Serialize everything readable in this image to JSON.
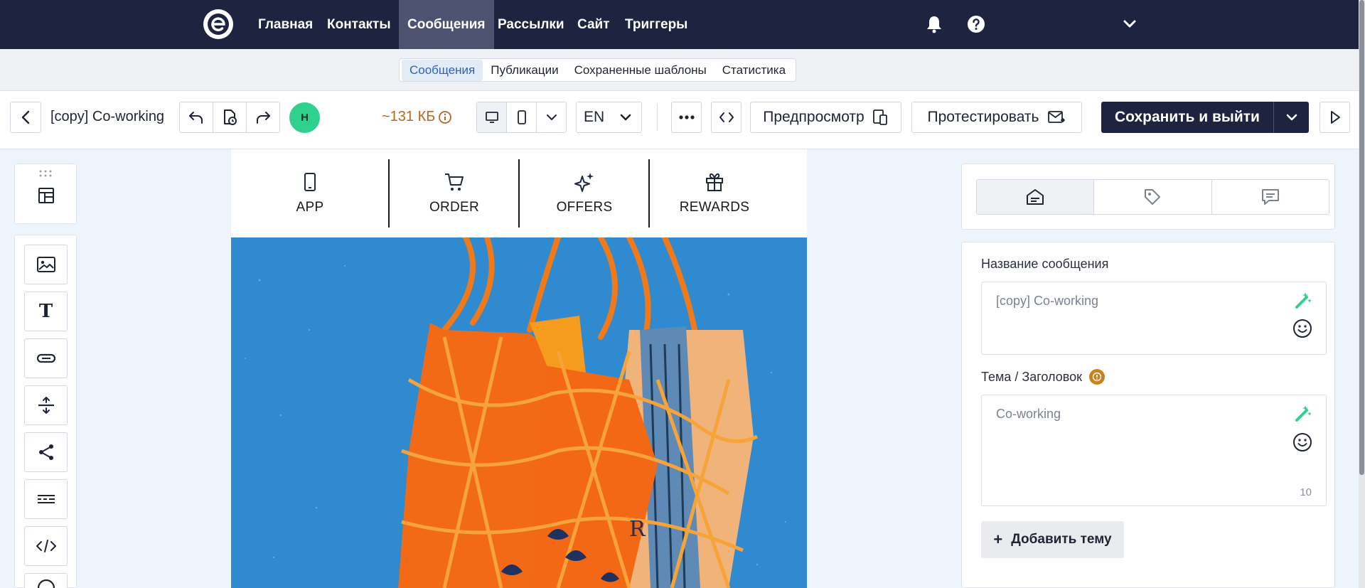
{
  "top_nav": {
    "items": [
      {
        "label": "Главная"
      },
      {
        "label": "Контакты"
      },
      {
        "label": "Сообщения",
        "active": true
      },
      {
        "label": "Рассылки"
      },
      {
        "label": "Сайт"
      },
      {
        "label": "Триггеры"
      }
    ],
    "icons": [
      "bell-icon",
      "help-icon",
      "chevron-down-icon"
    ]
  },
  "sub_nav": {
    "items": [
      {
        "label": "Сообщения",
        "active": true
      },
      {
        "label": "Публикации"
      },
      {
        "label": "Сохраненные шаблоны"
      },
      {
        "label": "Статистика"
      }
    ]
  },
  "toolbar": {
    "title": "[copy] Co-working",
    "avatar_initial": "Н",
    "size": "~131 КБ",
    "language": "EN",
    "preview_label": "Предпросмотр",
    "test_label": "Протестировать",
    "save_label": "Сохранить и выйти"
  },
  "email_menu": {
    "items": [
      {
        "label": "APP",
        "icon": "phone-icon"
      },
      {
        "label": "ORDER",
        "icon": "cart-icon"
      },
      {
        "label": "OFFERS",
        "icon": "sparkle-icon"
      },
      {
        "label": "REWARDS",
        "icon": "gift-icon"
      }
    ]
  },
  "left_tools": [
    "template-icon",
    "image-icon",
    "text-icon",
    "button-icon",
    "spacer-icon",
    "share-icon",
    "divider-icon",
    "code-icon"
  ],
  "right_panel": {
    "tabs": [
      "envelope-icon",
      "tag-icon",
      "message-icon"
    ],
    "message_name_label": "Название сообщения",
    "message_name_value": "[copy] Co-working",
    "subject_label": "Тема / Заголовок",
    "subject_value": "Co-working",
    "subject_count": "10",
    "add_subject_label": "Добавить тему"
  },
  "colors": {
    "nav_bg": "#1e2440",
    "accent_avatar": "#2ed28d",
    "size_warning": "#b7661f",
    "hero_blue": "#2f8ad0",
    "bag_orange": "#f26a16"
  }
}
